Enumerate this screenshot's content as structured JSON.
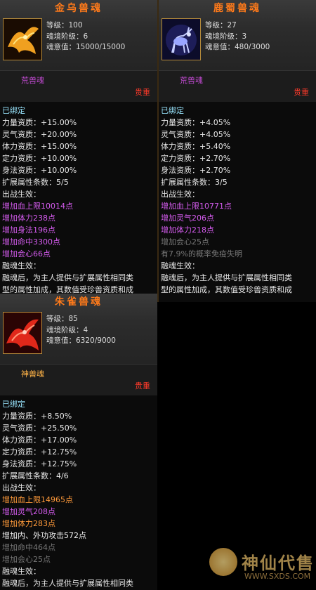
{
  "cards": [
    {
      "title": "金乌兽魂",
      "level": "等级：100",
      "realm": "魂境阶级：6",
      "soul_value": "魂意值：15000/15000",
      "soul_type": "荒兽魂",
      "rarity": "贵重",
      "bound": "已绑定",
      "attrs": [
        "力量资质：+15.00%",
        "灵气资质：+20.00%",
        "体力资质：+15.00%",
        "定力资质：+10.00%",
        "身法资质：+10.00%"
      ],
      "ext_count": "扩展属性条数：5/5",
      "battle_label": "出战生效：",
      "battle_effects": [
        {
          "text": "增加血上限10014点",
          "color": "purple"
        },
        {
          "text": "增加体力238点",
          "color": "purple"
        },
        {
          "text": "增加身法196点",
          "color": "purple"
        },
        {
          "text": "增加命中3300点",
          "color": "purple"
        },
        {
          "text": "增加会心66点",
          "color": "purple"
        }
      ],
      "merge_label": "融魂生效：",
      "merge_desc_1": "融魂后，为主人提供与扩展属性相同类",
      "merge_desc_2": "型的属性加成，其数值受珍兽资质和成"
    },
    {
      "title": "鹿蜀兽魂",
      "level": "等级：27",
      "realm": "魂境阶级：3",
      "soul_value": "魂意值：480/3000",
      "soul_type": "荒兽魂",
      "rarity": "贵重",
      "bound": "已绑定",
      "attrs": [
        "力量资质：+4.05%",
        "灵气资质：+4.05%",
        "体力资质：+5.40%",
        "定力资质：+2.70%",
        "身法资质：+2.70%"
      ],
      "ext_count": "扩展属性条数：3/5",
      "battle_label": "出战生效：",
      "battle_effects": [
        {
          "text": "增加血上限10771点",
          "color": "purple"
        },
        {
          "text": "增加灵气206点",
          "color": "purple"
        },
        {
          "text": "增加体力218点",
          "color": "purple"
        },
        {
          "text": "增加会心25点",
          "color": "gray"
        },
        {
          "text": "有7.9%的概率免疫失明",
          "color": "gray"
        }
      ],
      "merge_label": "融魂生效：",
      "merge_desc_1": "融魂后，为主人提供与扩展属性相同类",
      "merge_desc_2": "型的属性加成，其数值受珍兽资质和成"
    },
    {
      "title": "朱雀兽魂",
      "level": "等级：85",
      "realm": "魂境阶级：4",
      "soul_value": "魂意值：6320/9000",
      "soul_type": "神兽魂",
      "rarity": "贵重",
      "bound": "已绑定",
      "attrs": [
        "力量资质：+8.50%",
        "灵气资质：+25.50%",
        "体力资质：+17.00%",
        "定力资质：+12.75%",
        "身法资质：+12.75%"
      ],
      "ext_count": "扩展属性条数：4/6",
      "battle_label": "出战生效：",
      "battle_effects": [
        {
          "text": "增加血上限14965点",
          "color": "orange"
        },
        {
          "text": "增加灵气208点",
          "color": "purple"
        },
        {
          "text": "增加体力283点",
          "color": "orange"
        },
        {
          "text": "增加内、外功攻击572点",
          "color": "white"
        },
        {
          "text": "增加命中464点",
          "color": "gray"
        },
        {
          "text": "增加会心25点",
          "color": "gray"
        }
      ],
      "merge_label": "融魂生效：",
      "merge_desc_1": "融魂后，为主人提供与扩展属性相同类",
      "merge_desc_2": ""
    }
  ],
  "watermark": {
    "name": "神仙代售",
    "url": "WWW.SXDS.COM"
  }
}
